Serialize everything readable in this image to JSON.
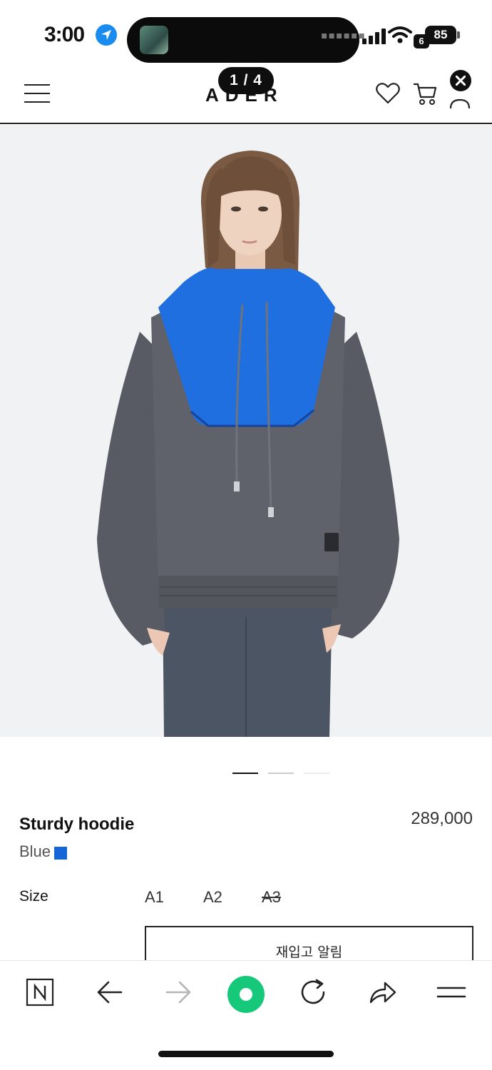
{
  "status_bar": {
    "time": "3:00",
    "battery": "85",
    "network_badge": "6"
  },
  "header": {
    "brand": "ADER",
    "image_counter": "1 / 4"
  },
  "gallery": {
    "total_images": 4,
    "active_index": 0
  },
  "product": {
    "name": "Sturdy hoodie",
    "price": "289,000",
    "color_name": "Blue",
    "color_hex": "#1565d8",
    "size_label": "Size",
    "sizes": [
      {
        "label": "A1",
        "sold_out": false
      },
      {
        "label": "A2",
        "sold_out": false
      },
      {
        "label": "A3",
        "sold_out": true
      }
    ],
    "restock_button": "재입고 알림"
  },
  "toolbar": {
    "items": [
      "naver-home",
      "back",
      "forward",
      "green-dot",
      "reload",
      "share",
      "menu"
    ]
  },
  "colors": {
    "accent_green": "#16c97a",
    "hoodie_grey": "#5a5d66",
    "hoodie_blue": "#1f6fe0"
  }
}
